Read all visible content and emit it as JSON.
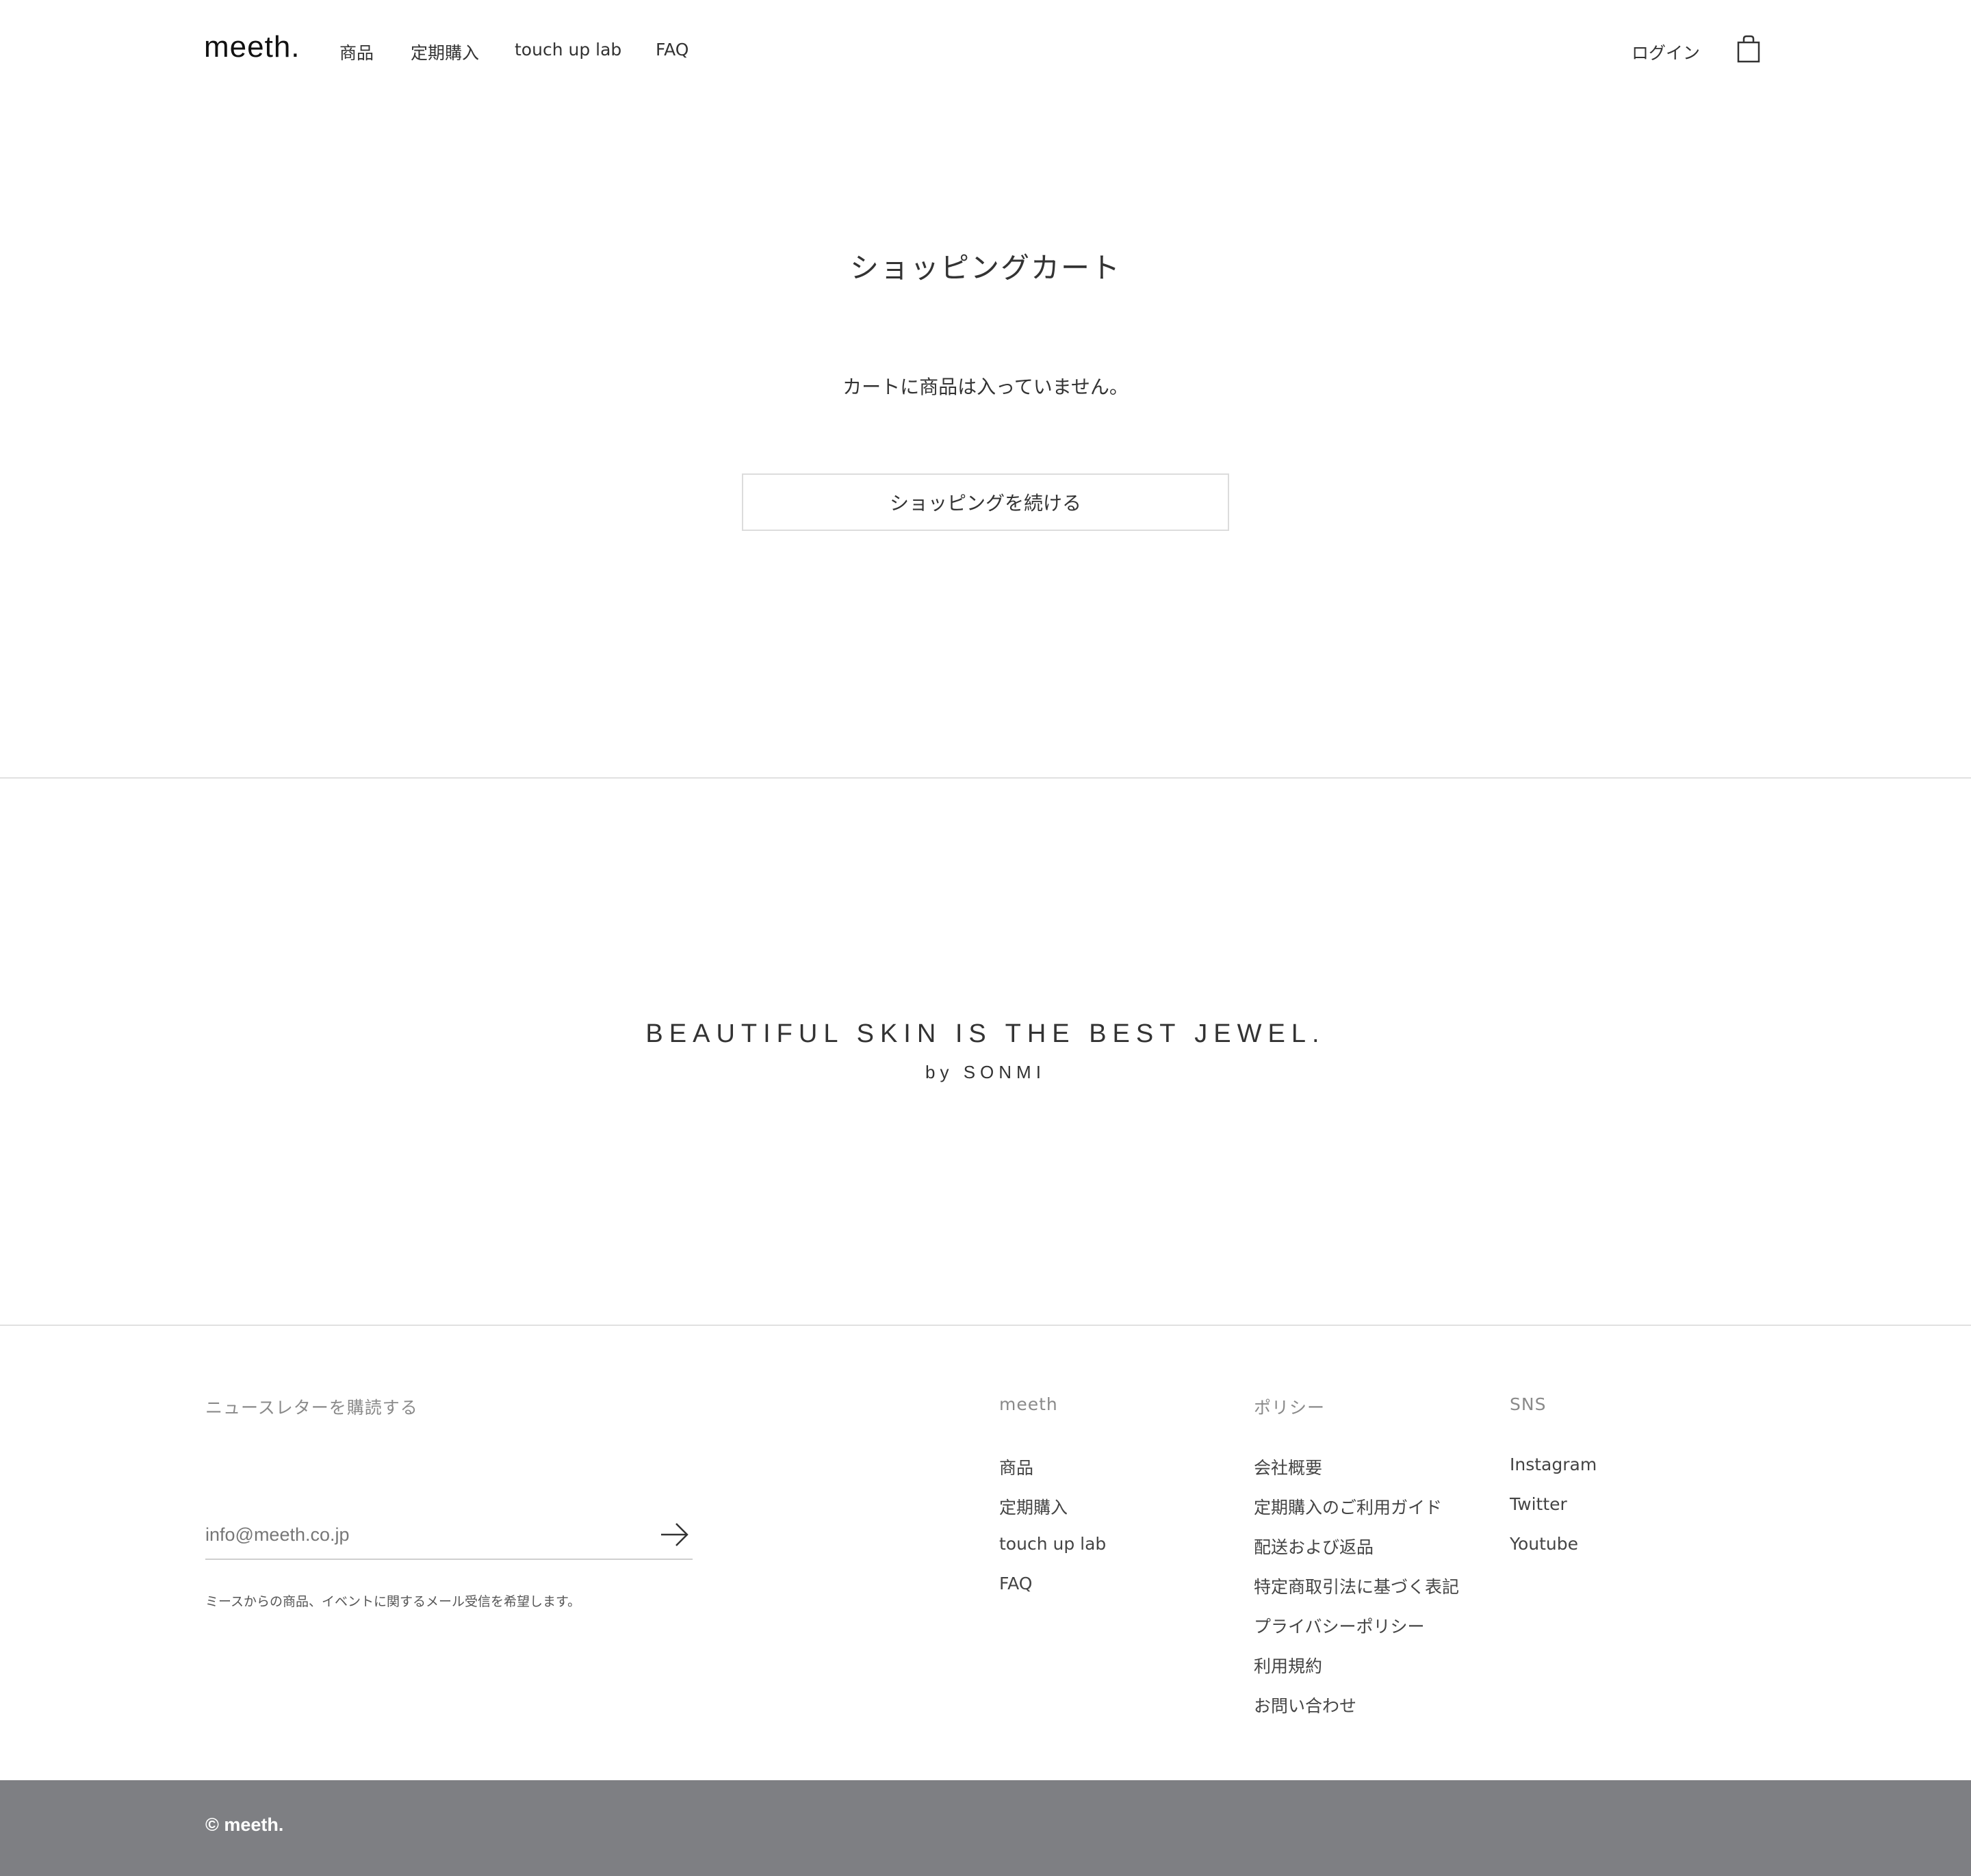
{
  "header": {
    "logo": "meeth.",
    "nav": [
      "商品",
      "定期購入",
      "touch up lab",
      "FAQ"
    ],
    "login": "ログイン",
    "cart_icon": "shopping-bag-icon"
  },
  "cart": {
    "title": "ショッピングカート",
    "empty_message": "カートに商品は入っていません。",
    "continue_button": "ショッピングを続ける"
  },
  "tagline": {
    "main": "BEAUTIFUL SKIN IS THE BEST JEWEL.",
    "by": "by SONMI"
  },
  "footer": {
    "newsletter": {
      "heading": "ニュースレターを購読する",
      "placeholder": "info@meeth.co.jp",
      "submit_icon": "arrow-right-icon",
      "consent": "ミースからの商品、イベントに関するメール受信を希望します。"
    },
    "columns": [
      {
        "heading": "meeth",
        "links": [
          "商品",
          "定期購入",
          "touch up lab",
          "FAQ"
        ]
      },
      {
        "heading": "ポリシー",
        "links": [
          "会社概要",
          "定期購入のご利用ガイド",
          "配送および返品",
          "特定商取引法に基づく表記",
          "プライバシーポリシー",
          "利用規約",
          "お問い合わせ"
        ]
      },
      {
        "heading": "SNS",
        "links": [
          "Instagram",
          "Twitter",
          "Youtube"
        ]
      }
    ],
    "copyright": "© meeth."
  }
}
